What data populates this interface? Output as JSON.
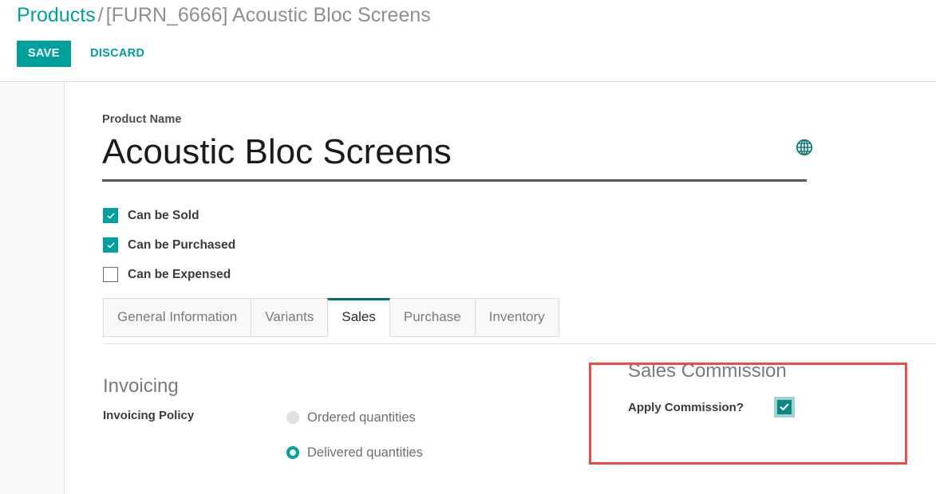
{
  "header": {
    "breadcrumb": {
      "root": "Products",
      "separator": "/",
      "current": "[FURN_6666] Acoustic Bloc Screens"
    },
    "save_label": "SAVE",
    "discard_label": "DISCARD"
  },
  "form": {
    "product_name_label": "Product Name",
    "product_name_value": "Acoustic Bloc Screens",
    "translate_icon": "globe-icon",
    "checkboxes": [
      {
        "label": "Can be Sold",
        "checked": true
      },
      {
        "label": "Can be Purchased",
        "checked": true
      },
      {
        "label": "Can be Expensed",
        "checked": false
      }
    ]
  },
  "notebook": {
    "tabs": [
      {
        "label": "General Information",
        "active": false
      },
      {
        "label": "Variants",
        "active": false
      },
      {
        "label": "Sales",
        "active": true
      },
      {
        "label": "Purchase",
        "active": false
      },
      {
        "label": "Inventory",
        "active": false
      }
    ]
  },
  "sales_tab": {
    "invoicing": {
      "title": "Invoicing",
      "policy_label": "Invoicing Policy",
      "options": [
        {
          "label": "Ordered quantities",
          "selected": false
        },
        {
          "label": "Delivered quantities",
          "selected": true
        }
      ]
    },
    "commission": {
      "title": "Sales Commission",
      "apply_label": "Apply Commission?",
      "apply_checked": true,
      "highlighted": true
    }
  },
  "colors": {
    "accent": "#00a09d",
    "accent_dark": "#00726f",
    "highlight": "#f04a47",
    "muted_text": "#7a7a7a",
    "label_text": "#3b3b3b"
  }
}
